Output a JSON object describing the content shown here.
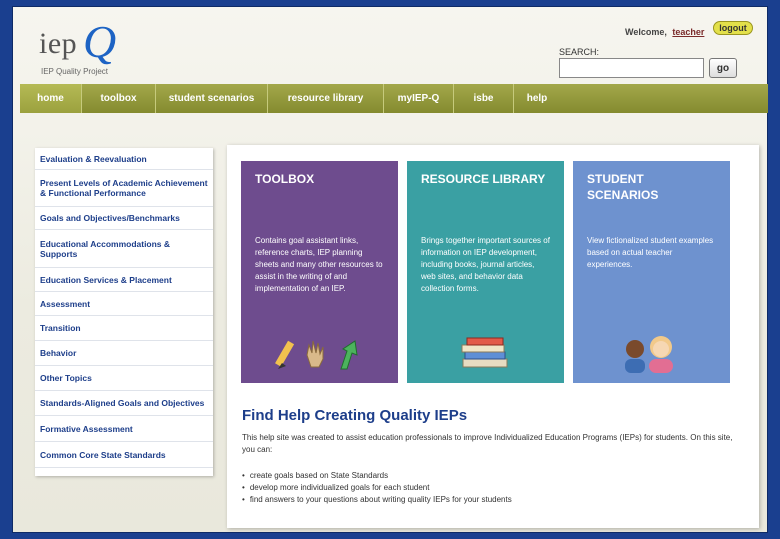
{
  "header": {
    "logo_main": "iep",
    "logo_q": "Q",
    "logo_sub": "IEP Quality Project",
    "welcome_prefix": "Welcome,",
    "username": "teacher",
    "logout_label": "logout",
    "search_label": "SEARCH:",
    "search_value": "",
    "go_label": "go"
  },
  "nav": {
    "items": [
      {
        "label": "home",
        "active": true
      },
      {
        "label": "toolbox"
      },
      {
        "label": "student scenarios"
      },
      {
        "label": "resource library"
      },
      {
        "label": "myIEP-Q"
      },
      {
        "label": "isbe"
      },
      {
        "label": "help"
      }
    ]
  },
  "sidebar": {
    "items": [
      {
        "label": "Evaluation & Reevaluation"
      },
      {
        "label": "Present Levels of Academic Achievement & Functional Performance"
      },
      {
        "label": "Goals and Objectives/Benchmarks"
      },
      {
        "label": "Educational Accommodations & Supports"
      },
      {
        "label": "Education Services & Placement"
      },
      {
        "label": "Assessment"
      },
      {
        "label": "Transition"
      },
      {
        "label": "Behavior"
      },
      {
        "label": "Other Topics"
      },
      {
        "label": "Standards-Aligned Goals and Objectives"
      },
      {
        "label": "Formative Assessment"
      },
      {
        "label": "Common Core State Standards"
      }
    ]
  },
  "tiles": [
    {
      "title": "TOOLBOX",
      "text": "Contains goal assistant links, reference charts, IEP planning sheets and many other resources to assist in the writing of and implementation of an IEP."
    },
    {
      "title": "RESOURCE LIBRARY",
      "text": "Brings together important sources of information on IEP development, including books, journal articles, web sites, and behavior data collection forms."
    },
    {
      "title": "STUDENT SCENARIOS",
      "text": "View fictionalized student examples based on actual teacher experiences."
    }
  ],
  "help": {
    "title": "Find Help Creating Quality IEPs",
    "body": "This help site was created to assist education professionals to improve Individualized Education Programs (IEPs) for students. On this site, you can:",
    "bullets": [
      "create goals based on State Standards",
      "develop more individualized goals for each student",
      "find answers to your questions about writing quality IEPs for your students"
    ]
  },
  "colors": {
    "nav": "#8f962f",
    "toolbox_tile": "#6e4c8e",
    "library_tile": "#3aa0a3",
    "scenarios_tile": "#6e92cf",
    "link": "#1d3e8a"
  }
}
